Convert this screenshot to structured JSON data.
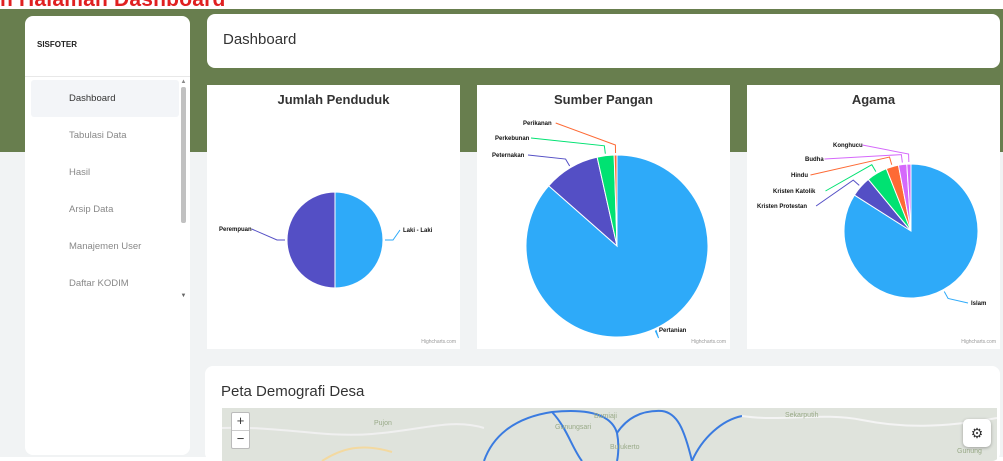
{
  "banner": "n Halaman Dashboard",
  "sidebar": {
    "brand": "SISFOTER",
    "items": [
      {
        "label": "Dashboard",
        "active": true
      },
      {
        "label": "Tabulasi Data"
      },
      {
        "label": "Hasil"
      },
      {
        "label": "Arsip Data"
      },
      {
        "label": "Manajemen User"
      },
      {
        "label": "Daftar KODIM"
      }
    ]
  },
  "header": {
    "title": "Dashboard"
  },
  "colors": {
    "green_band": "#687e4e",
    "slice_blue": "#2eaaf9",
    "slice_indigo": "#544fc5",
    "slice_green": "#00e272",
    "slice_orange": "#fe6a35",
    "slice_lavender": "#d568fb"
  },
  "credit": "Highcharts.com",
  "chart_data": [
    {
      "type": "pie",
      "title": "Jumlah Penduduk",
      "labels": [
        "Laki - Laki",
        "Perempuan"
      ],
      "values": [
        50,
        50
      ]
    },
    {
      "type": "pie",
      "title": "Sumber Pangan",
      "labels": [
        "Pertanian",
        "Peternakan",
        "Perkebunan",
        "Perikanan"
      ],
      "values": [
        86.5,
        10,
        3,
        0.5
      ]
    },
    {
      "type": "pie",
      "title": "Agama",
      "labels": [
        "Islam",
        "Kristen Protestan",
        "Kristen Katolik",
        "Hindu",
        "Budha",
        "Konghucu"
      ],
      "values": [
        84,
        5,
        5,
        3,
        2,
        1
      ]
    }
  ],
  "map": {
    "title": "Peta Demografi Desa",
    "zoom_in": "+",
    "zoom_out": "−",
    "places": [
      "Pujon",
      "Gunungsari",
      "Bumiaji",
      "Sekarputih",
      "Bulukerto",
      "Gunung"
    ]
  },
  "icons": {
    "settings": "gear-icon"
  }
}
